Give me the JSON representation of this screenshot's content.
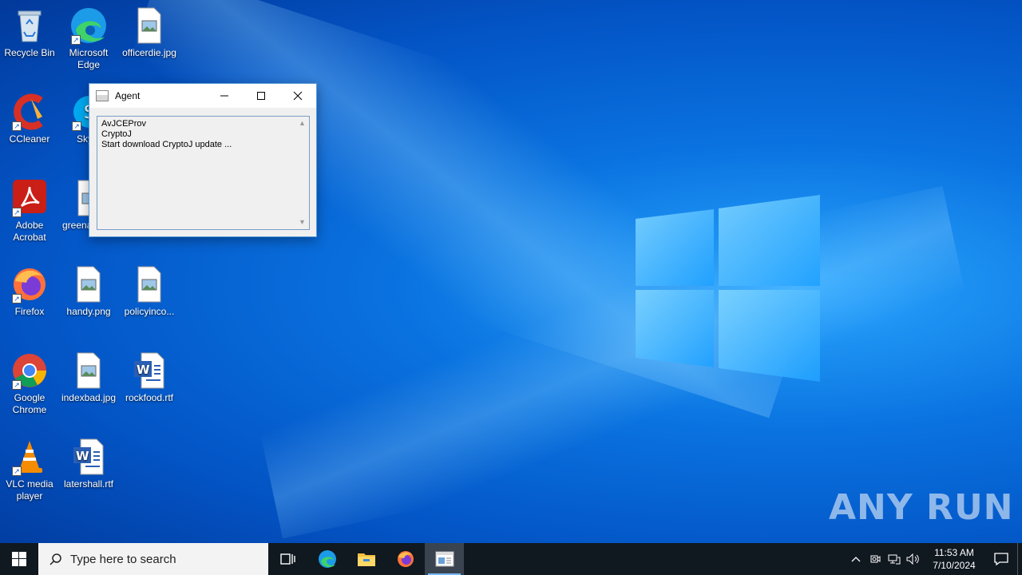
{
  "desktop_icons": [
    {
      "label": "Recycle Bin"
    },
    {
      "label": "Microsoft Edge"
    },
    {
      "label": "officerdie.jpg"
    },
    {
      "label": "CCleaner"
    },
    {
      "label": "Sky"
    },
    {
      "label": "Adobe Acrobat"
    },
    {
      "label": "greena"
    },
    {
      "label": "Firefox"
    },
    {
      "label": "handy.png"
    },
    {
      "label": "policyinco..."
    },
    {
      "label": "Google Chrome"
    },
    {
      "label": "indexbad.jpg"
    },
    {
      "label": "rockfood.rtf"
    },
    {
      "label": "VLC media player"
    },
    {
      "label": "latershall.rtf"
    }
  ],
  "window": {
    "title": "Agent",
    "lines": [
      "AvJCEProv",
      "CryptoJ",
      "Start download CryptoJ update ..."
    ]
  },
  "taskbar": {
    "search_placeholder": "Type here to search",
    "clock_time": "11:53 AM",
    "clock_date": "7/10/2024"
  },
  "watermark": "ANY RUN",
  "colors": {
    "taskbar": "#101820",
    "accent": "#0078d7"
  }
}
